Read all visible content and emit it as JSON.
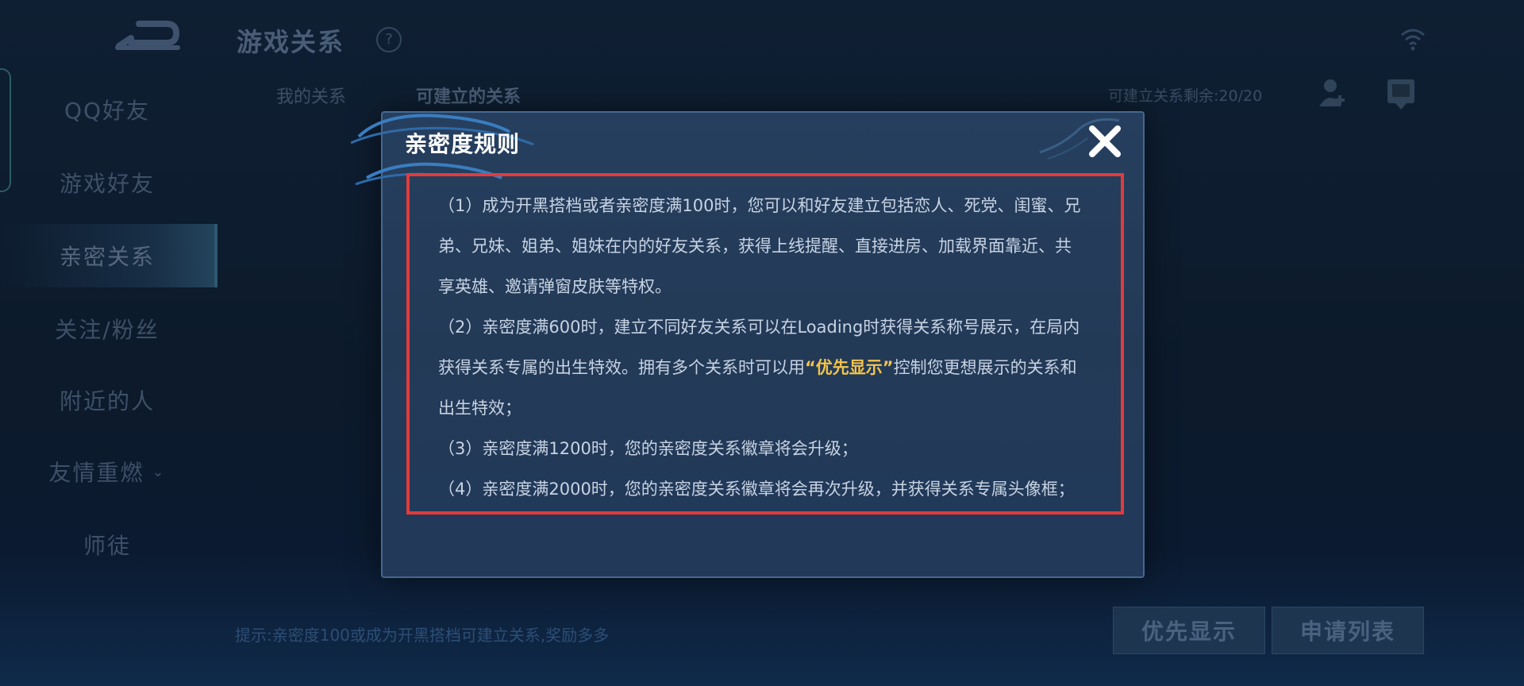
{
  "page": {
    "title": "游戏关系",
    "help_icon_text": "?"
  },
  "sidebar": {
    "items": [
      {
        "label": "QQ好友"
      },
      {
        "label": "游戏好友"
      },
      {
        "label": "亲密关系",
        "active": true
      },
      {
        "label": "关注/粉丝"
      },
      {
        "label": "附近的人"
      },
      {
        "label": "友情重燃",
        "chevron": "⌄"
      },
      {
        "label": "师徒"
      }
    ]
  },
  "tabs": [
    {
      "label": "我的关系"
    },
    {
      "label": "可建立的关系",
      "active": true
    }
  ],
  "quota": "可建立关系剩余:20/20",
  "footer": {
    "hint": "提示:亲密度100或成为开黑搭档可建立关系,奖励多多",
    "buttons": [
      {
        "label": "优先显示"
      },
      {
        "label": "申请列表"
      }
    ]
  },
  "modal": {
    "title": "亲密度规则",
    "rules": {
      "r1": "（1）成为开黑搭档或者亲密度满100时，您可以和好友建立包括恋人、死党、闺蜜、兄弟、兄妹、姐弟、姐妹在内的好友关系，获得上线提醒、直接进房、加载界面靠近、共享英雄、邀请弹窗皮肤等特权。",
      "r2_before": "（2）亲密度满600时，建立不同好友关系可以在Loading时获得关系称号展示，在局内获得关系专属的出生特效。拥有多个关系时可以用",
      "r2_highlight": "“优先显示”",
      "r2_after": "控制您更想展示的关系和出生特效；",
      "r3": "（3）亲密度满1200时，您的亲密度关系徽章将会升级；",
      "r4": "（4）亲密度满2000时，您的亲密度关系徽章将会再次升级，并获得关系专属头像框；"
    }
  },
  "colors": {
    "highlight_frame": "#e23b3b",
    "emphasis_text": "#f2c34b",
    "modal_bg": "#243c5a"
  },
  "icons": {
    "back": "back-arrow-icon",
    "help": "question-icon",
    "wifi": "wifi-icon",
    "close": "close-x-icon"
  }
}
